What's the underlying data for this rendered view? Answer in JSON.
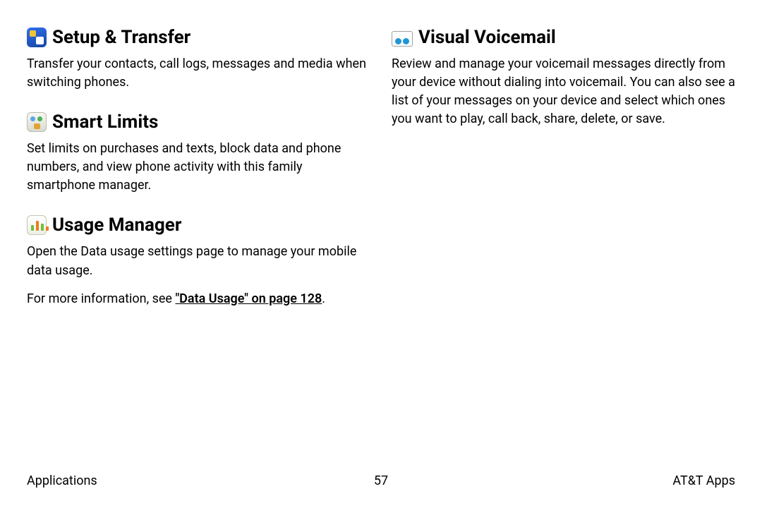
{
  "sections": {
    "setup_transfer": {
      "title": "Setup & Transfer",
      "body": "Transfer your contacts, call logs, messages and media when switching phones."
    },
    "smart_limits": {
      "title": "Smart Limits",
      "body": "Set limits on purchases and texts, block data and phone numbers, and view phone activity with this family smartphone manager."
    },
    "usage_manager": {
      "title": "Usage Manager",
      "body1": "Open the Data usage settings page to manage your mobile data usage.",
      "body2_prefix": "For more information, see ",
      "body2_link": "\"Data Usage\" on page 128",
      "body2_suffix": "."
    },
    "visual_voicemail": {
      "title": "Visual Voicemail",
      "body": "Review and manage your voicemail messages directly from your device without dialing into voicemail. You can also see a list of your messages on your device and select which ones you want to play, call back, share, delete, or save."
    }
  },
  "footer": {
    "left": "Applications",
    "center": "57",
    "right": "AT&T Apps"
  }
}
